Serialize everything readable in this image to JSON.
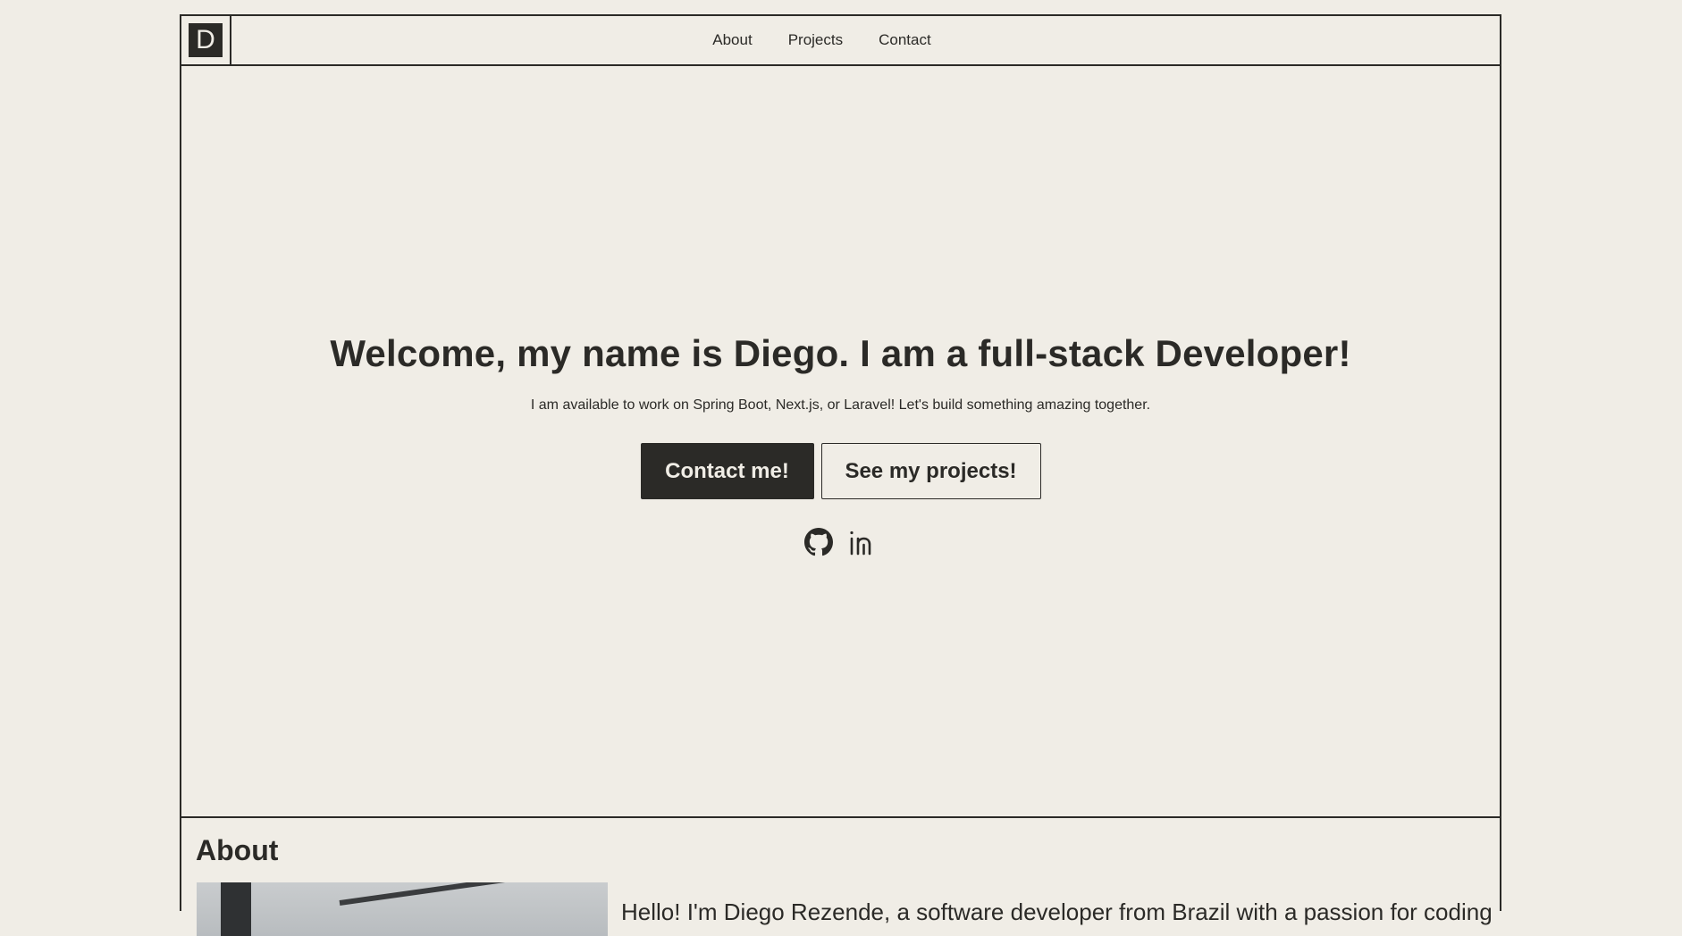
{
  "header": {
    "logo_letter": "D",
    "nav": [
      {
        "label": "About"
      },
      {
        "label": "Projects"
      },
      {
        "label": "Contact"
      }
    ]
  },
  "hero": {
    "title": "Welcome, my name is Diego. I am a full-stack Developer!",
    "subtitle": "I am available to work on Spring Boot, Next.js, or Laravel! Let's build something amazing together.",
    "primary_button": "Contact me!",
    "secondary_button": "See my projects!",
    "social_icons": [
      "github-icon",
      "linkedin-icon"
    ]
  },
  "about": {
    "title": "About",
    "intro": "Hello! I'm Diego Rezende, a software developer from Brazil with a passion for coding"
  },
  "colors": {
    "background": "#f0ede6",
    "ink": "#2b2a27"
  }
}
